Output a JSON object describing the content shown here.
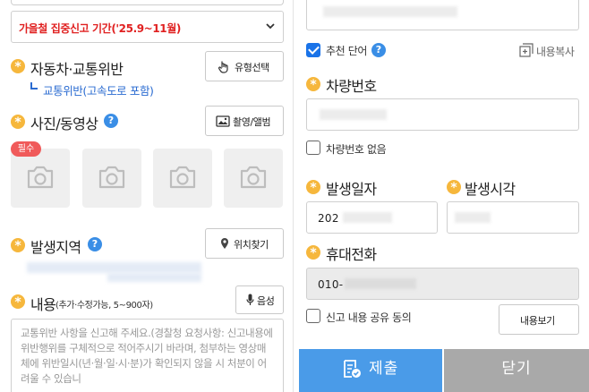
{
  "period_select": {
    "value": "가을철 집중신고 기간('25.9~11월)"
  },
  "vehicle_section": {
    "label": "자동차·교통위반",
    "type_button": "유형선택",
    "sub_type": "교통위반(고속도로 포함)"
  },
  "photo_section": {
    "label": "사진/동영상",
    "help": "?",
    "capture_button": "촬영/앨범",
    "required_badge": "필수",
    "slots": [
      "camera-slot-1",
      "camera-slot-2",
      "camera-slot-3",
      "camera-slot-4"
    ]
  },
  "location_section": {
    "label": "발생지역",
    "help": "?",
    "find_button": "위치찾기"
  },
  "content_section": {
    "label": "내용",
    "hint": "(추가·수정가능, 5~900자)",
    "voice_button": "음성",
    "placeholder": "교통위반 사항을 신고해 주세요.(경찰청 요청사항: 신고내용에 위반행위를 구체적으로 적어주시기 바라며, 첨부하는 영상매체에 위반일시(년·월·일·시·분)가 확인되지 않을 시 처분이 어려울 수 있습니"
  },
  "recommend": {
    "label": "추천 단어",
    "checked": true,
    "help": "?"
  },
  "copy_button": "내용복사",
  "plate_section": {
    "label": "차량번호",
    "no_plate_label": "차량번호 없음",
    "no_plate_checked": false
  },
  "date_section": {
    "label": "발생일자",
    "value": "202"
  },
  "time_section": {
    "label": "발생시각"
  },
  "phone_section": {
    "label": "휴대전화",
    "value": "010-"
  },
  "share_consent": {
    "label": "신고 내용 공유 동의",
    "checked": false
  },
  "view_button": "내용보기",
  "submit_button": "제출",
  "close_button": "닫기",
  "colors": {
    "accent_blue": "#3a8ee6",
    "submit_bg": "#4a9be8",
    "close_bg": "#a9a9a9",
    "required_star": "#f6b73c",
    "alert_red": "#e02121"
  }
}
